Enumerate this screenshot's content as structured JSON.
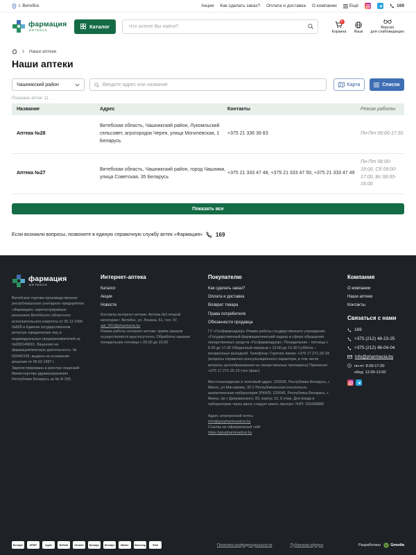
{
  "topbar": {
    "city": "г. Витебск",
    "links": [
      "Акции",
      "Как сделать заказ?",
      "Оплата и доставка",
      "О компании",
      "Ещё"
    ],
    "phone": "169"
  },
  "header": {
    "logo_main": "фармация",
    "logo_sub": "ВИТЕБСК",
    "catalog_label": "Каталог",
    "search_placeholder": "Что хотите Вы найти?",
    "cart_label": "Корзина",
    "cart_count": "1",
    "lang_label": "Язык",
    "vision_label_1": "Версия",
    "vision_label_2": "для слабовидящих"
  },
  "breadcrumb": {
    "current": "Наши аптеки"
  },
  "page_title": "Наши аптеки",
  "filters": {
    "district": "Чашникский район",
    "address_placeholder": "Введите адрес или название",
    "map_label": "Карта",
    "list_label": "Список"
  },
  "count_text": "Показано аптек: 11",
  "table": {
    "headers": [
      "Название",
      "Адрес",
      "Контакты",
      "Режим работы"
    ],
    "rows": [
      {
        "name": "Аптека №28",
        "address": "Витебская область, Чашникский район, Лукомльский сельсовет, агрогородок Черея, улица Могилевская, 1 Беларусь",
        "contacts": "+375 21 336 39 83",
        "hours": "Пн-Пт 09:00-17:30"
      },
      {
        "name": "Аптека №27",
        "address": "Витебская область, Чашникский район, город Чашники, улица Советская, 35 Беларусь",
        "contacts": "+375 21 333 47 48, +375 21 333 47 50, +375 21 333 47 49",
        "hours": "Пн-Пт 08:00-19:00, Сб 09:00-17:00, Вс 08:00-16:00"
      }
    ]
  },
  "show_all_label": "Показать все",
  "help_text": "Если возникли вопросы, позвоните в единую справочную службу аптек «Фармация»",
  "help_phone": "169",
  "footer": {
    "about": "Витебское торгово-производственное республиканское унитарное предприятие «Фармация» зарегистрировано решением Витебского областного исполнительного комитета от 30.12.1996 №605 в Едином государственном регистре юридических лиц и индивидуальных предпринимателей за №300149691. Лицензия на фармацевтическую деятельность: № 02040/155, выдана на основании решения от 05.02.1997 г. Зарегистрирована в реестре лицензий Министерства здравоохранения Республики Беларусь за № Ф-155.",
    "shop_title": "Интернет-аптека",
    "shop_links": [
      "Каталог",
      "Акции",
      "Новости"
    ],
    "shop_info_1": "Контакты интернет-аптеки: Аптека №1 второй категории г. Витебск, ул. Ленина, 61, тел. 47.",
    "shop_email": "apt_001@pharmacia.by",
    "shop_info_2": "Режим работы интернет-аптеки: приём заказов осуществляется круглосуточно; Обработка заказов: понедельник–пятница с 09.00 до 20.00",
    "buyer_title": "Покупателю",
    "buyer_links": [
      "Как сделать заказ?",
      "Оплата и доставка",
      "Возврат товара",
      "Права потребителя",
      "Обязанности продавца"
    ],
    "buyer_info_1": "ГУ «Госфармнадзор» Режим работы государственного учреждения «Государственный фармацевтический надзор в сфере обращения лекарственных средств «Госфармнадзор»: Понедельник – пятница с 8.30 до 17.00 Обеденный перерыв с 13.00 до 13.30 Суббота – воскресенье выходной. Телефоны: Горячая линия: +375 17 271-20-34 (вопросы справочно-консультационного характера, в том числе вопросы ценообразования на лекарственные препараты) Приемная: +375 17 271-25-15 (тел./факс)",
    "buyer_info_2": "Местонахождение и почтовый адрес: 220030, Республика Беларусь, г. Минск, ул.Мясникова, 32-2 Республиканская контрольно-аналитическая лаборатория (РКАЛ): 220045, Республика Беларусь, г. Минск, пр-т Дзержинского, 83, корпус 15, 8 этаж. Для входа в лабораторию через вахту следует иметь паспорт. УНП: 193408888",
    "buyer_info_3": "Адрес электронной почты",
    "buyer_email": "info@gospharmnadzor.by",
    "buyer_info_4": "Ссылка на официальный сайт",
    "buyer_site": "https://gospharmnadzor.by",
    "company_title": "Компания",
    "company_links": [
      "О компании",
      "Наши аптеки",
      "Контакты"
    ],
    "contact_title": "Связаться с нами",
    "contacts": [
      "169",
      "+375 (212) 48-23-25",
      "+375 (212) 48-04-04",
      "info@pharmacia.by"
    ],
    "hours_1": "пн-пт: 8.00-17.00",
    "hours_2": "обед: 12.00-13.00",
    "payments": [
      "Белкарт",
      "ЕРИП",
      "Apple",
      "BePaid",
      "Оплати",
      "Белкарт",
      "Белкарт",
      "Master",
      "Samsung",
      "VISA"
    ],
    "privacy_label": "Политика конфиденциальности",
    "public_offer_label": "Публичная оферта",
    "developer_label": "Разработано",
    "developer_name": "Gmedia"
  },
  "colors": {
    "brand_green": "#146b45",
    "accent_blue": "#3f6fb4",
    "footer_bg": "#1e2226"
  }
}
